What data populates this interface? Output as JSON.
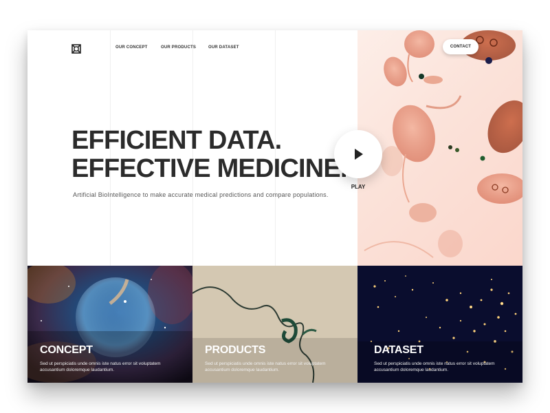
{
  "nav": {
    "items": [
      "OUR CONCEPT",
      "OUR PRODUCTS",
      "OUR DATASET"
    ],
    "contact_label": "CONTACT"
  },
  "hero": {
    "headline_line1": "EFFICIENT DATA.",
    "headline_line2": "EFFECTIVE MEDICINE.",
    "subline": "Artificial BioIntelligence to make accurate medical predictions and compare populations.",
    "play_label": "PLAY"
  },
  "cards": [
    {
      "title": "CONCEPT",
      "desc": "Sed ut perspiciatis unde omnis iste natus error sit voluptatem accusantium doloremque laudantium."
    },
    {
      "title": "PRODUCTS",
      "desc": "Sed ut perspiciatis unde omnis iste natus error sit voluptatem accusantium doloremque laudantium."
    },
    {
      "title": "DATASET",
      "desc": "Sed ut perspiciatis unde omnis iste natus error sit voluptatem accusantium doloremque laudantium."
    }
  ],
  "colors": {
    "text_dark": "#2b2b2b",
    "accent_salmon": "#e8937a",
    "space_blue": "#1d3a63",
    "night_navy": "#0a0d2e"
  }
}
